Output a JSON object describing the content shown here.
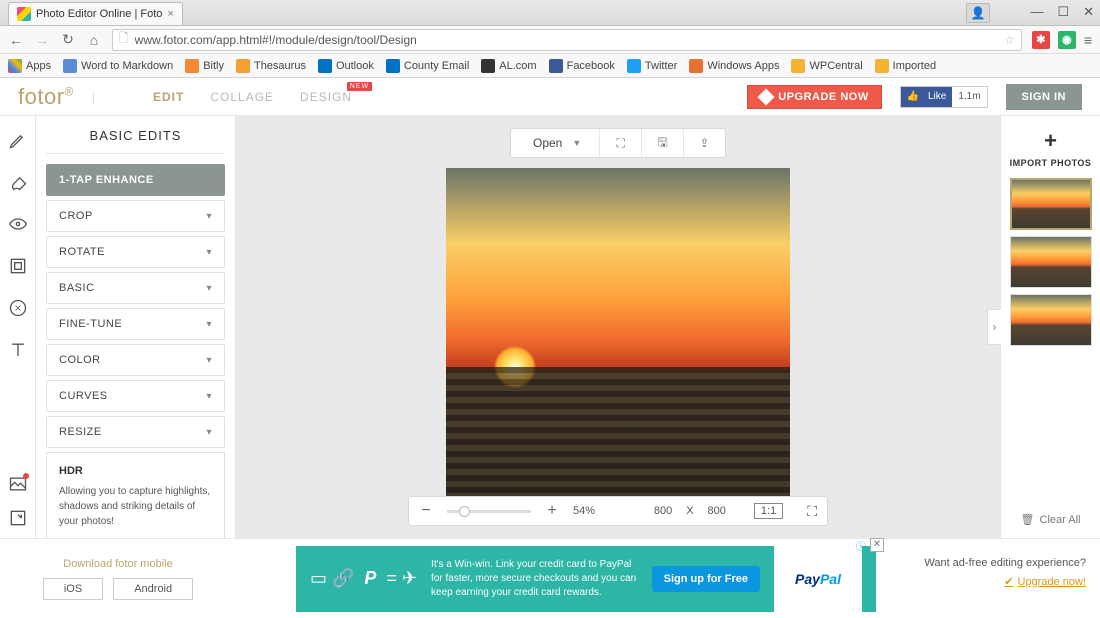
{
  "browser": {
    "tabTitle": "Photo Editor Online | Foto",
    "url": "www.fotor.com/app.html#!/module/design/tool/Design",
    "winCtrls": {
      "min": "—",
      "max": "☐",
      "close": "✕"
    },
    "bookmarks": [
      {
        "label": "Apps",
        "color": "#e84646"
      },
      {
        "label": "Word to Markdown",
        "color": "#5a8dd6"
      },
      {
        "label": "Bitly",
        "color": "#f38b33"
      },
      {
        "label": "Thesaurus",
        "color": "#f3a033"
      },
      {
        "label": "Outlook",
        "color": "#0072c6"
      },
      {
        "label": "County Email",
        "color": "#0072c6"
      },
      {
        "label": "AL.com",
        "color": "#333"
      },
      {
        "label": "Facebook",
        "color": "#3b5998"
      },
      {
        "label": "Twitter",
        "color": "#1da1f2"
      },
      {
        "label": "Windows Apps",
        "color": "#e87033"
      },
      {
        "label": "WPCentral",
        "color": "#f3b333"
      },
      {
        "label": "Imported",
        "color": "#f3b333"
      }
    ]
  },
  "header": {
    "logo": "fotor",
    "nav": [
      {
        "label": "EDIT",
        "active": true
      },
      {
        "label": "COLLAGE",
        "active": false
      },
      {
        "label": "DESIGN",
        "active": false,
        "badge": "NEW"
      }
    ],
    "upgrade": "UPGRADE NOW",
    "fbLike": "Like",
    "fbCount": "1.1m",
    "signin": "SIGN IN"
  },
  "panel": {
    "title": "BASIC EDITS",
    "items": [
      {
        "label": "1-TAP ENHANCE",
        "active": true,
        "expandable": false
      },
      {
        "label": "CROP"
      },
      {
        "label": "ROTATE"
      },
      {
        "label": "BASIC"
      },
      {
        "label": "FINE-TUNE"
      },
      {
        "label": "COLOR"
      },
      {
        "label": "CURVES"
      },
      {
        "label": "RESIZE"
      }
    ],
    "hdr": {
      "title": "HDR",
      "desc": "Allowing you to capture highlights, shadows and striking details of your photos!"
    }
  },
  "canvas": {
    "open": "Open",
    "zoom": "54%",
    "dims": {
      "w": "800",
      "x": "X",
      "h": "800"
    },
    "ratio": "1:1"
  },
  "right": {
    "import": "IMPORT PHOTOS",
    "clear": "Clear All"
  },
  "bottom": {
    "download": "Download fotor mobile",
    "ios": "iOS",
    "android": "Android",
    "adText": "It's a Win-win. Link your credit card to PayPal for faster, more secure checkouts and you can keep earning your credit card rewards.",
    "adCta": "Sign up for Free",
    "paypal": "PayPal",
    "adfreeQ": "Want ad-free editing experience?",
    "adfreeA": "Upgrade now!"
  }
}
